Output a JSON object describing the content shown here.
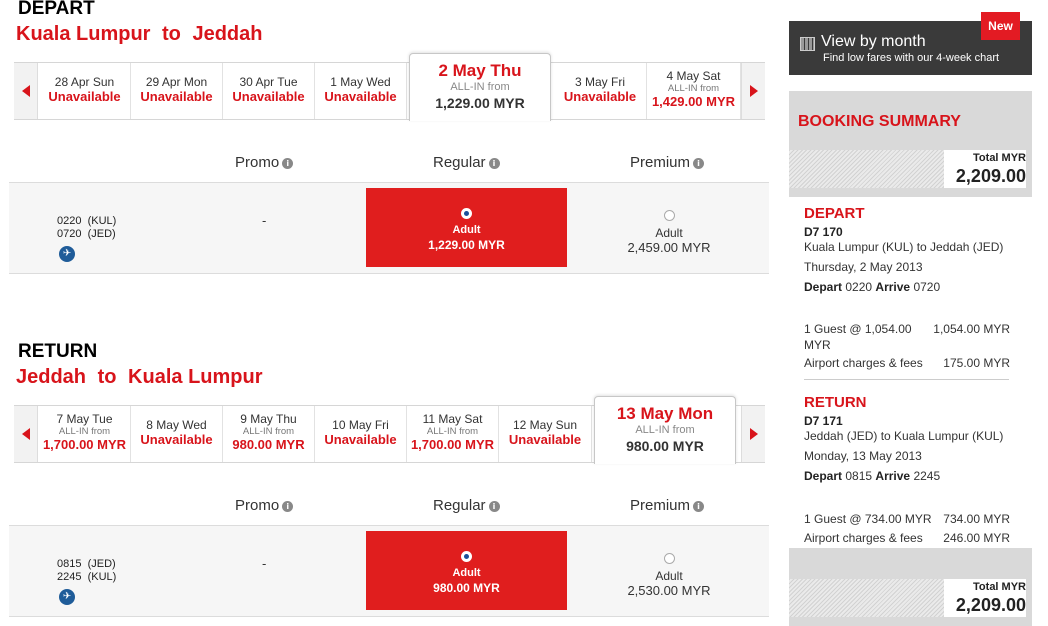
{
  "depart": {
    "heading": "DEPART",
    "route": {
      "from": "Kuala Lumpur",
      "to_word": "to",
      "to": "Jeddah"
    },
    "dates": [
      {
        "label": "28 Apr Sun",
        "value": "Unavailable"
      },
      {
        "label": "29 Apr Mon",
        "value": "Unavailable"
      },
      {
        "label": "30 Apr Tue",
        "value": "Unavailable"
      },
      {
        "label": "1 May Wed",
        "value": "Unavailable"
      },
      {
        "label": "2 May Thu",
        "sub": "ALL-IN from",
        "value": "1,229.00 MYR",
        "selected": true
      },
      {
        "label": "3 May Fri",
        "value": "Unavailable"
      },
      {
        "label": "4 May Sat",
        "sub": "ALL-IN from",
        "value": "1,429.00 MYR"
      }
    ],
    "fare_headers": {
      "promo": "Promo",
      "regular": "Regular",
      "premium": "Premium"
    },
    "flight": {
      "depart_time": "0220",
      "depart_code": "(KUL)",
      "arrive_time": "0720",
      "arrive_code": "(JED)",
      "promo": "-",
      "regular_type": "Adult",
      "regular_price": "1,229.00 MYR",
      "premium_type": "Adult",
      "premium_price": "2,459.00 MYR"
    }
  },
  "return": {
    "heading": "RETURN",
    "route": {
      "from": "Jeddah",
      "to_word": "to",
      "to": "Kuala Lumpur"
    },
    "dates": [
      {
        "label": "7 May Tue",
        "sub": "ALL-IN from",
        "value": "1,700.00 MYR"
      },
      {
        "label": "8 May Wed",
        "value": "Unavailable"
      },
      {
        "label": "9 May Thu",
        "sub": "ALL-IN from",
        "value": "980.00 MYR"
      },
      {
        "label": "10 May Fri",
        "value": "Unavailable"
      },
      {
        "label": "11 May Sat",
        "sub": "ALL-IN from",
        "value": "1,700.00 MYR"
      },
      {
        "label": "12 May Sun",
        "value": "Unavailable"
      },
      {
        "label": "13 May Mon",
        "sub": "ALL-IN from",
        "value": "980.00 MYR",
        "selected": true
      }
    ],
    "fare_headers": {
      "promo": "Promo",
      "regular": "Regular",
      "premium": "Premium"
    },
    "flight": {
      "depart_time": "0815",
      "depart_code": "(JED)",
      "arrive_time": "2245",
      "arrive_code": "(KUL)",
      "promo": "-",
      "regular_type": "Adult",
      "regular_price": "980.00 MYR",
      "premium_type": "Adult",
      "premium_price": "2,530.00 MYR"
    }
  },
  "view_month": {
    "title": "View by month",
    "subtitle": "Find low fares with our 4-week chart",
    "badge": "New"
  },
  "summary": {
    "title": "BOOKING SUMMARY",
    "total_label": "Total MYR",
    "total_value": "2,209.00",
    "depart": {
      "title": "DEPART",
      "flight_no": "D7 170",
      "route": "Kuala Lumpur (KUL) to Jeddah (JED)",
      "date": "Thursday, 2 May 2013",
      "depart_word": "Depart",
      "depart_time": "0220",
      "arrive_word": "Arrive",
      "arrive_time": "0720",
      "guest_line1": "1 Guest @ 1,054.00",
      "guest_line2": "MYR",
      "guest_amount": "1,054.00 MYR",
      "fees_label": "Airport charges & fees",
      "fees_amount": "175.00 MYR"
    },
    "return": {
      "title": "RETURN",
      "flight_no": "D7 171",
      "route": "Jeddah (JED) to Kuala Lumpur (KUL)",
      "date": "Monday, 13 May 2013",
      "depart_word": "Depart",
      "depart_time": "0815",
      "arrive_word": "Arrive",
      "arrive_time": "2245",
      "guest_line1": "1 Guest @ 734.00 MYR",
      "guest_amount": "734.00 MYR",
      "fees_label": "Airport charges & fees",
      "fees_amount": "246.00 MYR"
    }
  },
  "colors": {
    "accent": "#d8141b",
    "regular_fill": "#e01e1e",
    "dark_panel": "#3a3a3a",
    "summary_bg": "#d9d9d9"
  },
  "icons": {
    "prev": "chevron-left-icon",
    "next": "chevron-right-icon",
    "info": "info-icon",
    "plane": "plane-icon",
    "calendar": "calendar-icon"
  }
}
